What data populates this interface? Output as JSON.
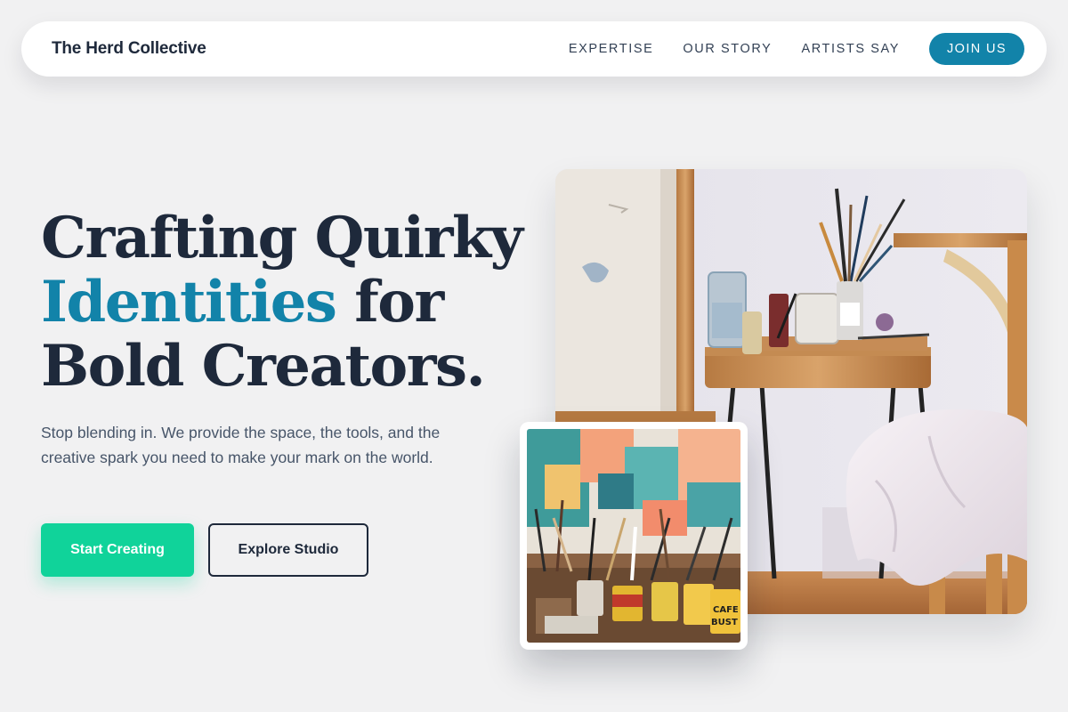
{
  "nav": {
    "brand": "The Herd Collective",
    "links": [
      "EXPERTISE",
      "OUR STORY",
      "ARTISTS SAY"
    ],
    "cta": "JOIN US"
  },
  "hero": {
    "title_line1": "Crafting Quirky",
    "title_accent": "Identities",
    "title_line2_rest": " for",
    "title_line3": "Bold Creators.",
    "subtitle": "Stop blending in. We provide the space, the tools, and the creative spark you need to make your mark on the world.",
    "primary_button": "Start Creating",
    "secondary_button": "Explore Studio"
  },
  "images": {
    "main": "art-studio-easel-photo",
    "inset": "paint-brushes-jars-photo"
  },
  "colors": {
    "accent": "#1283a9",
    "primary_button": "#10d39a",
    "heading": "#1e293b",
    "background": "#f1f1f2"
  }
}
